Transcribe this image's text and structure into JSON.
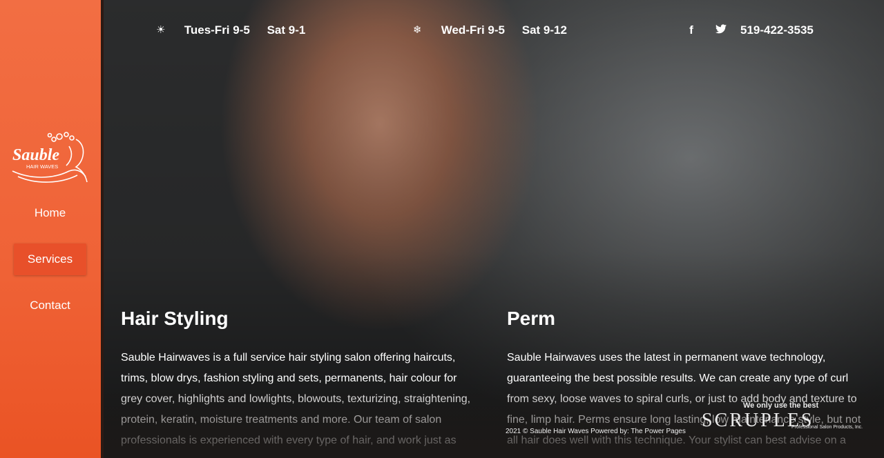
{
  "sidebar": {
    "logo_text": "Sauble",
    "logo_subtext": "HAIR WAVES",
    "nav": [
      {
        "label": "Home"
      },
      {
        "label": "Services"
      },
      {
        "label": "Contact"
      }
    ],
    "active_index": 1
  },
  "topbar": {
    "summer_icon": "sun-icon",
    "summer_days": "Tues-Fri 9-5",
    "summer_sat": "Sat 9-1",
    "winter_icon": "snowflake-icon",
    "winter_days": "Wed-Fri 9-5",
    "winter_sat": "Sat 9-12",
    "social": [
      {
        "icon": "facebook-icon",
        "glyph": "f"
      },
      {
        "icon": "twitter-icon",
        "glyph": "🐦"
      }
    ],
    "phone": "519-422-3535"
  },
  "services": [
    {
      "title": "Hair Styling",
      "text": "Sauble Hairwaves is a full service hair styling salon offering haircuts, trims, blow drys, fashion styling and sets, permanents, hair colour for grey cover, highlights and lowlights, blowouts, texturizing, straightening, protein, keratin, moisture treatments and more. Our team of salon professionals is experienced with every type of hair, and work just as"
    },
    {
      "title": "Perm",
      "text": "Sauble Hairwaves uses the latest in permanent wave technology, guaranteeing the best possible results. We can create any type of curl from sexy, loose waves to spiral curls, or just to add body and texture to fine, limp hair. Perms ensure long lasting, low maintenance style, but not all hair does well with this technique. Your stylist can best advise on a"
    }
  ],
  "footer": {
    "copyright": "2021 © Sauble Hair Waves Powered by: The Power Pages"
  },
  "brand": {
    "tagline": "We only use the best",
    "name": "SCRUPLES",
    "sub": "Professional Salon Products, Inc."
  },
  "colors": {
    "accent": "#f26e43",
    "active_nav": "#e8502a"
  }
}
